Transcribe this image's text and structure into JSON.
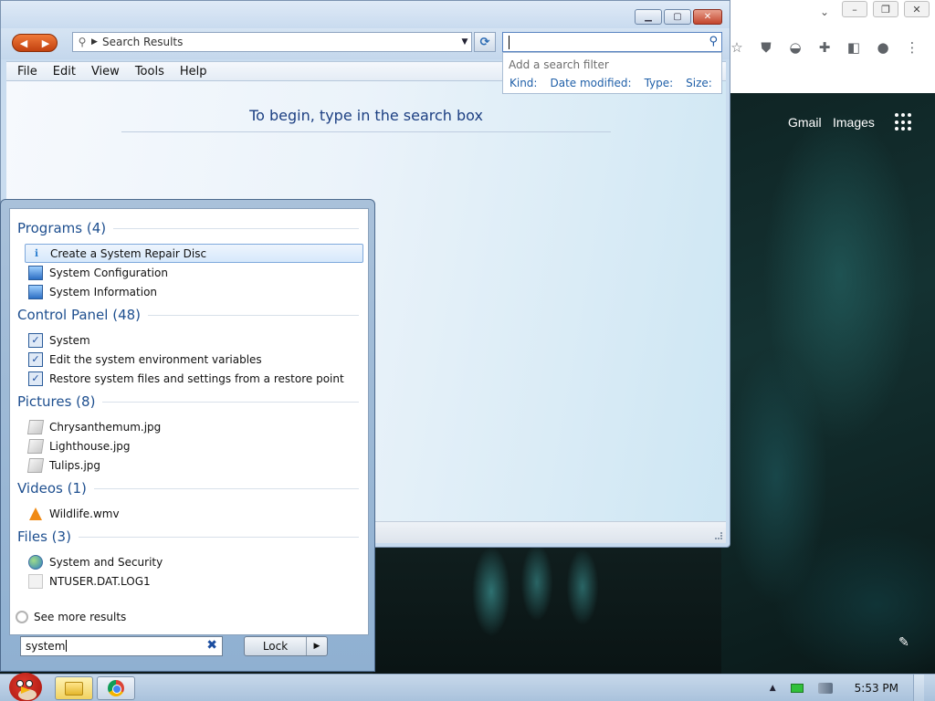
{
  "explorer": {
    "address": "Search Results",
    "search_value": "",
    "filter": {
      "hint": "Add a search filter",
      "kinds": [
        "Kind:",
        "Date modified:",
        "Type:",
        "Size:"
      ]
    },
    "menu": [
      "File",
      "Edit",
      "View",
      "Tools",
      "Help"
    ],
    "empty_message": "To begin, type in the search box"
  },
  "browser": {
    "links": [
      "Gmail",
      "Images"
    ]
  },
  "start_menu": {
    "groups": [
      {
        "title": "Programs (4)",
        "items": [
          {
            "label": "Create a System Repair Disc",
            "icon": "repair-disc-icon"
          },
          {
            "label": "System Configuration",
            "icon": "system-configuration-icon"
          },
          {
            "label": "System Information",
            "icon": "system-information-icon"
          }
        ]
      },
      {
        "title": "Control Panel (48)",
        "items": [
          {
            "label": "System",
            "icon": "control-panel-icon"
          },
          {
            "label": "Edit the system environment variables",
            "icon": "control-panel-icon"
          },
          {
            "label": "Restore system files and settings from a restore point",
            "icon": "control-panel-icon"
          }
        ]
      },
      {
        "title": "Pictures (8)",
        "items": [
          {
            "label": "Chrysanthemum.jpg",
            "icon": "picture-file-icon"
          },
          {
            "label": "Lighthouse.jpg",
            "icon": "picture-file-icon"
          },
          {
            "label": "Tulips.jpg",
            "icon": "picture-file-icon"
          }
        ]
      },
      {
        "title": "Videos (1)",
        "items": [
          {
            "label": "Wildlife.wmv",
            "icon": "vlc-cone-icon"
          }
        ]
      },
      {
        "title": "Files (3)",
        "items": [
          {
            "label": "System and Security",
            "icon": "globe-shield-icon"
          },
          {
            "label": "NTUSER.DAT.LOG1",
            "icon": "blank-file-icon"
          }
        ]
      }
    ],
    "see_more": "See more results",
    "search_value": "system",
    "lock_label": "Lock"
  },
  "taskbar": {
    "clock": "5:53 PM"
  }
}
